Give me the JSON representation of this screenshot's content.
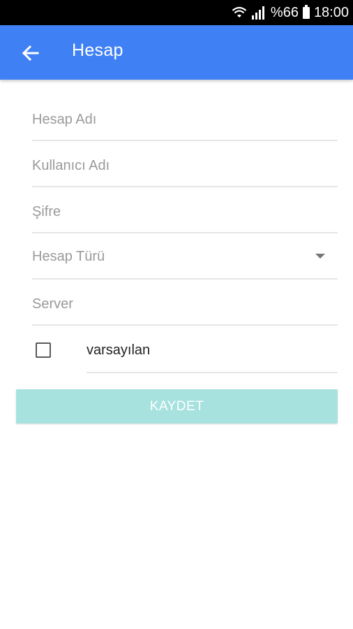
{
  "status_bar": {
    "battery_text": "%66",
    "time": "18:00",
    "icons": [
      "wifi-icon",
      "signal-icon",
      "battery-icon"
    ]
  },
  "app_bar": {
    "title": "Hesap",
    "back_icon": "arrow-left-icon",
    "background_color": "#3f80f4"
  },
  "form": {
    "account_name_placeholder": "Hesap Adı",
    "username_placeholder": "Kullanıcı Adı",
    "password_placeholder": "Şifre",
    "account_type_label": "Hesap Türü",
    "server_placeholder": "Server",
    "default_checkbox_label": "varsayılan",
    "default_checked": false
  },
  "save_button": {
    "label": "KAYDET",
    "color": "#a7e2df"
  }
}
